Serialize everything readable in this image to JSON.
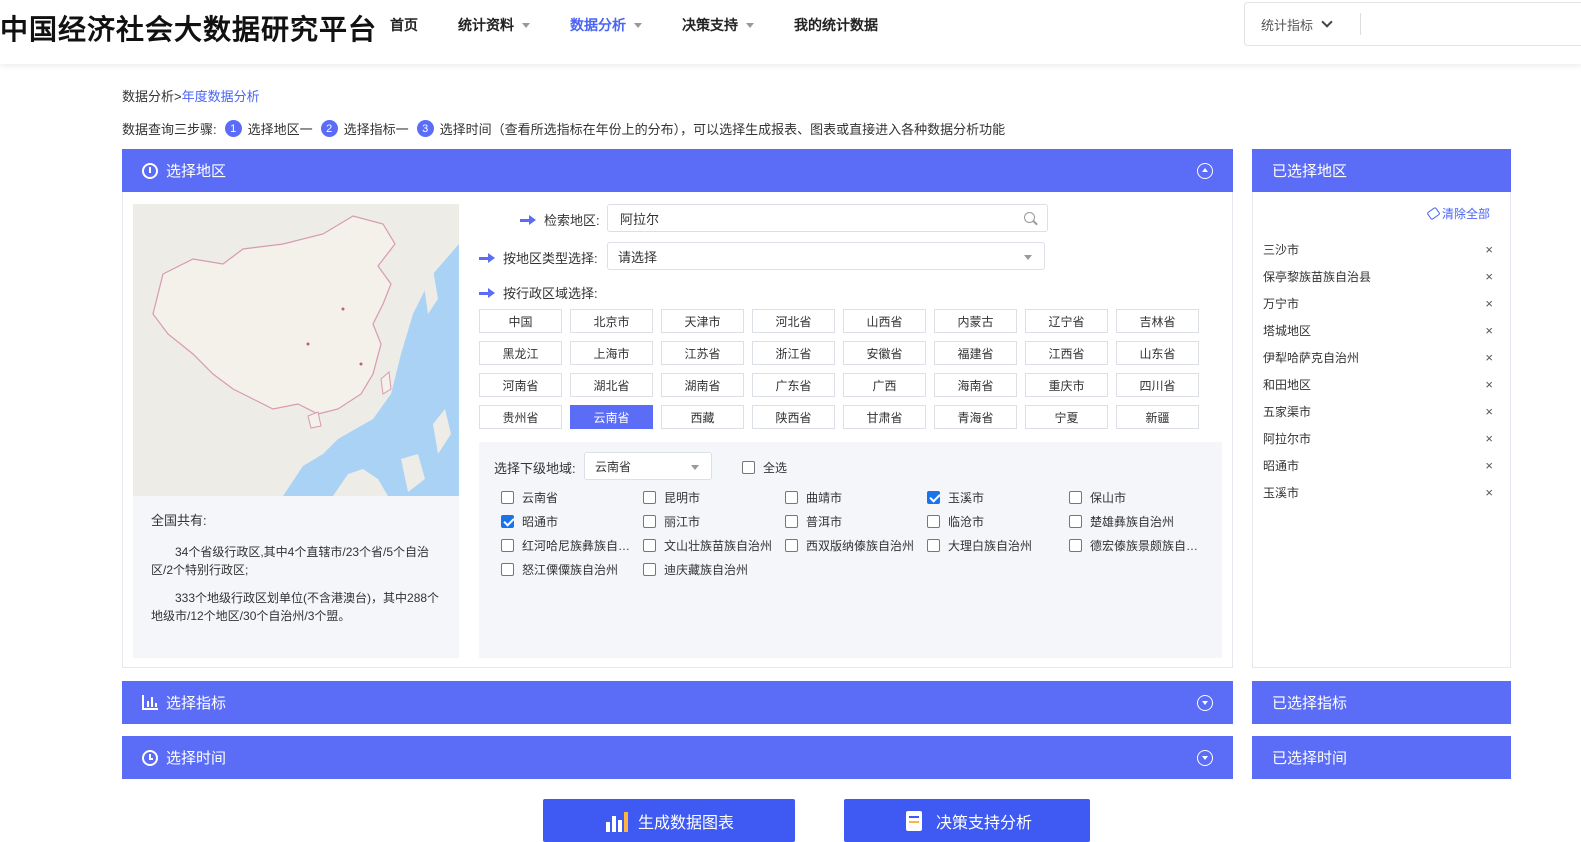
{
  "header": {
    "logo": "中国经济社会大数据研究平台",
    "nav": [
      {
        "label": "首页",
        "dropdown": false,
        "active": false
      },
      {
        "label": "统计资料",
        "dropdown": true,
        "active": false
      },
      {
        "label": "数据分析",
        "dropdown": true,
        "active": true
      },
      {
        "label": "决策支持",
        "dropdown": true,
        "active": false
      },
      {
        "label": "我的统计数据",
        "dropdown": false,
        "active": false
      }
    ],
    "search_type": "统计指标"
  },
  "breadcrumb": {
    "root": "数据分析",
    "sep": ">",
    "current": "年度数据分析"
  },
  "steps": {
    "prefix": "数据查询三步骤:",
    "s1_num": "1",
    "s1": "选择地区一",
    "s2_num": "2",
    "s2": "选择指标一",
    "s3_num": "3",
    "s3": "选择时间（查看所选指标在年份上的分布），可以选择生成报表、图表或直接进入各种数据分析功能"
  },
  "region_panel": {
    "title": "选择地区",
    "search_label": "检索地区:",
    "search_value": "阿拉尔",
    "type_label": "按地区类型选择:",
    "type_value": "请选择",
    "admin_label": "按行政区域选择:",
    "provinces": [
      "中国",
      "北京市",
      "天津市",
      "河北省",
      "山西省",
      "内蒙古",
      "辽宁省",
      "吉林省",
      "黑龙江",
      "上海市",
      "江苏省",
      "浙江省",
      "安徽省",
      "福建省",
      "江西省",
      "山东省",
      "河南省",
      "湖北省",
      "湖南省",
      "广东省",
      "广西",
      "海南省",
      "重庆市",
      "四川省",
      "贵州省",
      "云南省",
      "西藏",
      "陕西省",
      "甘肃省",
      "青海省",
      "宁夏",
      "新疆"
    ],
    "active_province": "云南省",
    "sub_label": "选择下级地域:",
    "sub_value": "云南省",
    "select_all": "全选",
    "cities": [
      {
        "name": "云南省",
        "checked": false
      },
      {
        "name": "昆明市",
        "checked": false
      },
      {
        "name": "曲靖市",
        "checked": false
      },
      {
        "name": "玉溪市",
        "checked": true
      },
      {
        "name": "保山市",
        "checked": false
      },
      {
        "name": "昭通市",
        "checked": true
      },
      {
        "name": "丽江市",
        "checked": false
      },
      {
        "name": "普洱市",
        "checked": false
      },
      {
        "name": "临沧市",
        "checked": false
      },
      {
        "name": "楚雄彝族自治州",
        "checked": false
      },
      {
        "name": "红河哈尼族彝族自治州",
        "checked": false
      },
      {
        "name": "文山壮族苗族自治州",
        "checked": false
      },
      {
        "name": "西双版纳傣族自治州",
        "checked": false
      },
      {
        "name": "大理白族自治州",
        "checked": false
      },
      {
        "name": "德宏傣族景颇族自治州",
        "checked": false
      },
      {
        "name": "怒江傈僳族自治州",
        "checked": false
      },
      {
        "name": "迪庆藏族自治州",
        "checked": false
      }
    ],
    "info_title": "全国共有:",
    "info_p1": "34个省级行政区,其中4个直辖市/23个省/5个自治区/2个特别行政区;",
    "info_p2": "333个地级行政区划单位(不含港澳台)，其中288个地级市/12个地区/30个自治州/3个盟。"
  },
  "selected_region": {
    "title": "已选择地区",
    "clear_all": "清除全部",
    "items": [
      "三沙市",
      "保亭黎族苗族自治县",
      "万宁市",
      "塔城地区",
      "伊犁哈萨克自治州",
      "和田地区",
      "五家渠市",
      "阿拉尔市",
      "昭通市",
      "玉溪市"
    ],
    "remove_glyph": "×"
  },
  "indicator_panel": {
    "title": "选择指标",
    "selected_title": "已选择指标"
  },
  "time_panel": {
    "title": "选择时间",
    "selected_title": "已选择时间"
  },
  "buttons": {
    "chart": "生成数据图表",
    "decision": "决策支持分析"
  },
  "colors": {
    "accent": "#5b6cf6",
    "button": "#3e5af3",
    "active_nav": "#4a64f5"
  }
}
